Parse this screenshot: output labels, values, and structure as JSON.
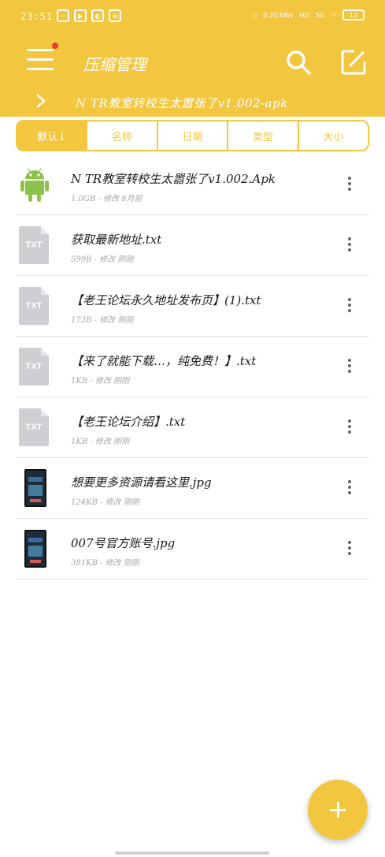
{
  "status_bar": {
    "time": "23:51",
    "net_speed": "0.20 KB/s",
    "hd": "HD",
    "signal": "5G",
    "battery": "12"
  },
  "header": {
    "title": "压缩管理",
    "path": "N TR教室转校生太嚣张了v1.002-apk"
  },
  "sort_tabs": [
    {
      "label": "默认↓",
      "active": true
    },
    {
      "label": "名称",
      "active": false
    },
    {
      "label": "日期",
      "active": false
    },
    {
      "label": "类型",
      "active": false
    },
    {
      "label": "大小",
      "active": false
    }
  ],
  "files": [
    {
      "name": "N TR教室转校生太嚣张了v1.002.Apk",
      "meta": "1.0GB - 修改 8月前",
      "icon": "android-icon"
    },
    {
      "name": "获取最新地址.txt",
      "meta": "599B - 修改 刚刚",
      "icon": "txt-file-icon"
    },
    {
      "name": "【老王论坛永久地址发布页】(1).txt",
      "meta": "173B - 修改 刚刚",
      "icon": "txt-file-icon"
    },
    {
      "name": "【来了就能下载…，纯免费！】.txt",
      "meta": "1KB - 修改 刚刚",
      "icon": "txt-file-icon"
    },
    {
      "name": "【老王论坛介绍】.txt",
      "meta": "1KB - 修改 刚刚",
      "icon": "txt-file-icon"
    },
    {
      "name": "想要更多资源请看这里.jpg",
      "meta": "124KB - 修改 刚刚",
      "icon": "image-thumbnail"
    },
    {
      "name": "007号官方账号.jpg",
      "meta": "381KB - 修改 刚刚",
      "icon": "image-thumbnail"
    }
  ],
  "txt_label": "TXT",
  "colors": {
    "accent": "#F3C63F",
    "android_green": "#8BC34A",
    "notification_dot": "#E53935"
  }
}
